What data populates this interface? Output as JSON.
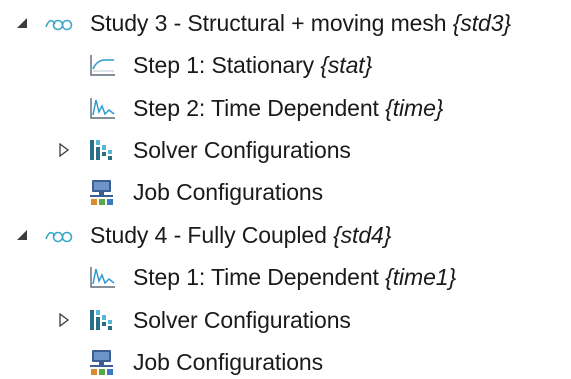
{
  "tree": {
    "studies": [
      {
        "title": "Study 3 -  Structural + moving mesh ",
        "tag": "{std3}",
        "expanded": true,
        "icon": "study-icon",
        "children": [
          {
            "title": "Step 1: Stationary ",
            "tag": "{stat}",
            "icon": "stationary-step-icon"
          },
          {
            "title": "Step 2: Time Dependent ",
            "tag": "{time}",
            "icon": "time-dependent-step-icon"
          },
          {
            "title": "Solver Configurations",
            "tag": "",
            "icon": "solver-configurations-icon",
            "expandable": true
          },
          {
            "title": "Job Configurations",
            "tag": "",
            "icon": "job-configurations-icon"
          }
        ]
      },
      {
        "title": "Study 4 - Fully Coupled ",
        "tag": "{std4}",
        "expanded": true,
        "icon": "study-icon",
        "children": [
          {
            "title": "Step 1: Time Dependent ",
            "tag": "{time1}",
            "icon": "time-dependent-step-icon"
          },
          {
            "title": "Solver Configurations",
            "tag": "",
            "icon": "solver-configurations-icon",
            "expandable": true
          },
          {
            "title": "Job Configurations",
            "tag": "",
            "icon": "job-configurations-icon"
          }
        ]
      }
    ]
  },
  "colors": {
    "study_icon": "#3aa6c8",
    "toggle": "#3c3c3c",
    "chart_axis": "#5b6a78",
    "chart_curve": "#2e9ad0",
    "solver_dark": "#2a6f86",
    "solver_light": "#55b8d8",
    "job_monitor": "#3b5f95",
    "job_screen": "#6d95c8",
    "job_blocks": [
      "#d98a2c",
      "#5aa84a",
      "#3a79c2"
    ]
  }
}
